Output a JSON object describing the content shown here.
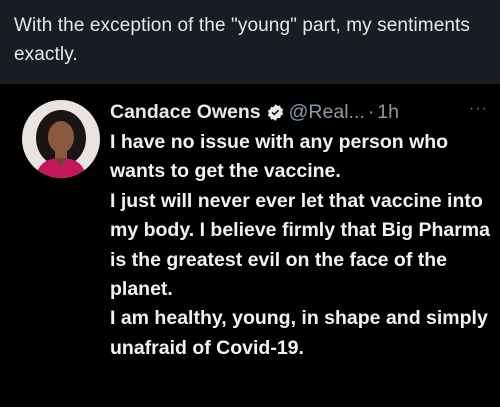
{
  "post": {
    "text": "With the exception of the \"young\" part, my sentiments exactly."
  },
  "tweet": {
    "author_name": "Candace Owens",
    "handle": "@Real...",
    "separator": "·",
    "time": "1h",
    "more_label": "···",
    "text": "I have no issue with any person who wants to get the vaccine.\nI just will never ever let that vaccine into my body. I believe firmly that Big Pharma is the greatest evil on the face of the planet.\nI am healthy, young, in shape and simply unafraid of Covid-19.",
    "verified_icon": "verified-badge-icon",
    "avatar_icon": "profile-photo"
  },
  "colors": {
    "background": "#0f1519",
    "embed_background": "#000000",
    "text_primary": "#e7e9ea",
    "text_secondary": "#8b98a5"
  }
}
